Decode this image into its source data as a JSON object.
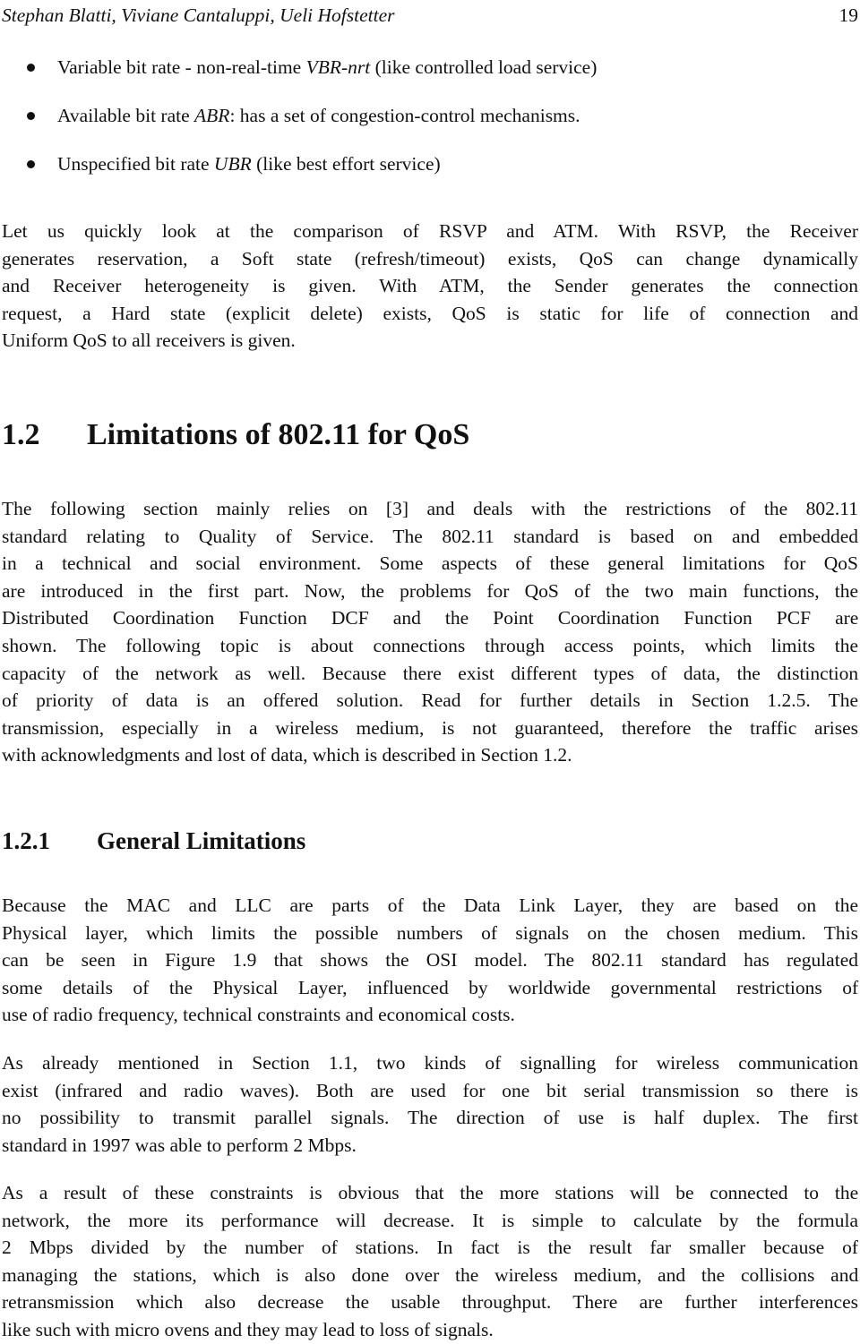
{
  "running_head": {
    "authors": "Stephan Blatti, Viviane Cantaluppi, Ueli Hofstetter",
    "page_number": "19"
  },
  "bullets": [
    {
      "before": "Variable bit rate - non-real-time ",
      "term": "VBR-nrt",
      "after": " (like controlled load service)"
    },
    {
      "before": "Available bit rate ",
      "term": "ABR",
      "after": ": has a set of congestion-control mechanisms."
    },
    {
      "before": "Unspecified bit rate ",
      "term": "UBR",
      "after": " (like best effort service)"
    }
  ],
  "paragraph_rsvp_atm": [
    "Let us quickly look at the comparison of RSVP and ATM. With RSVP, the Receiver",
    "generates reservation, a Soft state (refresh/timeout) exists, QoS can change dynamically",
    "and Receiver heterogeneity is given.  With ATM, the Sender generates the connection",
    "request, a Hard state (explicit delete) exists, QoS is static for life of connection and",
    "Uniform QoS to all receivers is given."
  ],
  "section": {
    "number": "1.2",
    "title": "Limitations of 802.11 for QoS",
    "paragraph": [
      "The following section mainly relies on [3] and deals with the restrictions of the 802.11",
      "standard relating to Quality of Service.  The 802.11 standard is based on and embedded",
      "in a technical and social environment. Some aspects of these general limitations for QoS",
      "are introduced in the first part. Now, the problems for QoS of the two main functions, the",
      "Distributed Coordination Function DCF and the Point Coordination Function PCF are",
      "shown.  The following topic is about connections through access points, which limits the",
      "capacity of the network as well. Because there exist different types of data, the distinction",
      "of priority of data is an offered solution.  Read for further details in Section 1.2.5.  The",
      "transmission, especially in a wireless medium, is not guaranteed, therefore the traffic arises",
      "with acknowledgments and lost of data, which is described in Section 1.2."
    ]
  },
  "subsection": {
    "number": "1.2.1",
    "title": "General Limitations",
    "paragraphs": [
      [
        "Because the MAC and LLC are parts of the Data Link Layer, they are based on the",
        "Physical layer, which limits the possible numbers of signals on the chosen medium.  This",
        "can be seen in Figure 1.9 that shows the OSI model.  The 802.11 standard has regulated",
        "some details of the Physical Layer, influenced by worldwide governmental restrictions of",
        "use of radio frequency, technical constraints and economical costs."
      ],
      [
        "As already mentioned in Section 1.1, two kinds of signalling for wireless communication",
        "exist (infrared and radio waves). Both are used for one bit serial transmission so there is",
        "no possibility to transmit parallel signals.  The direction of use is half duplex.  The first",
        "standard in 1997 was able to perform 2 Mbps."
      ],
      [
        "As a result of these constraints is obvious that the more stations will be connected to the",
        "network, the more its performance will decrease.  It is simple to calculate by the formula",
        "2 Mbps divided by the number of stations.  In fact is the result far smaller because of",
        "managing the stations, which is also done over the wireless medium, and the collisions and",
        "retransmission which also decrease the usable throughput.  There are further interferences",
        "like such with micro ovens and they may lead to loss of signals."
      ]
    ]
  }
}
